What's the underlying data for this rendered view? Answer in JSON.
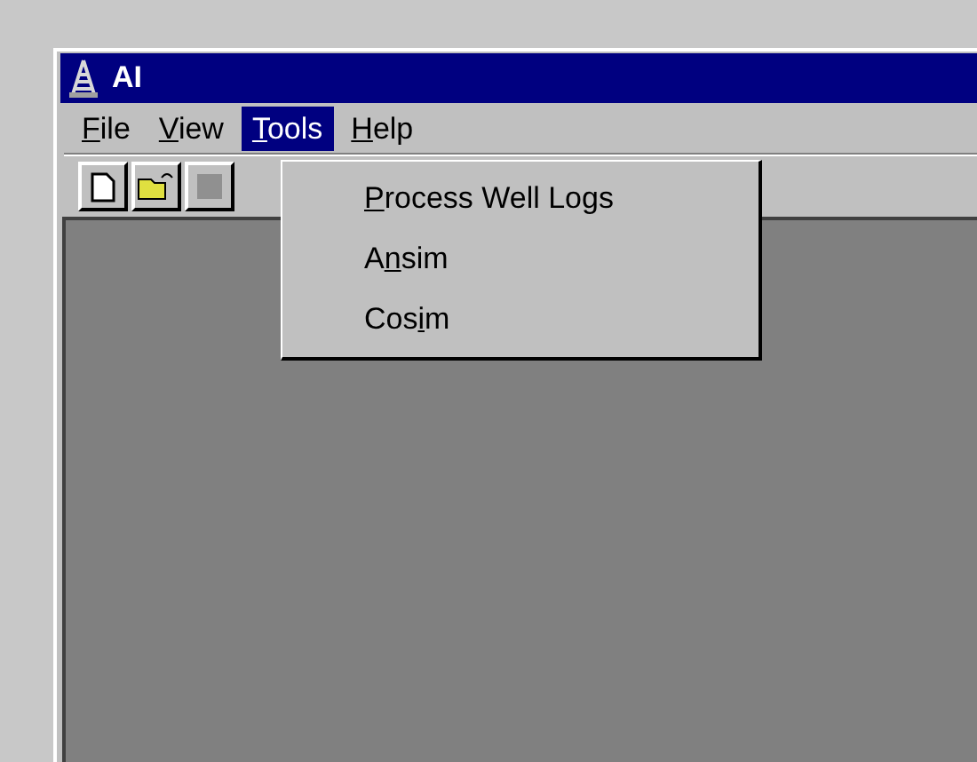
{
  "window": {
    "title": "AI"
  },
  "menu": [
    {
      "mnemonic": "F",
      "rest": "ile",
      "selected": false
    },
    {
      "mnemonic": "V",
      "rest": "iew",
      "selected": false
    },
    {
      "mnemonic": "T",
      "rest": "ools",
      "selected": true
    },
    {
      "mnemonic": "H",
      "rest": "elp",
      "selected": false
    }
  ],
  "dropdown": [
    {
      "mnemonic": "P",
      "rest": "rocess Well Logs"
    },
    {
      "prefix": "A",
      "mnemonic": "n",
      "rest": "sim"
    },
    {
      "prefix": "Cos",
      "mnemonic": "i",
      "rest": "m"
    }
  ]
}
